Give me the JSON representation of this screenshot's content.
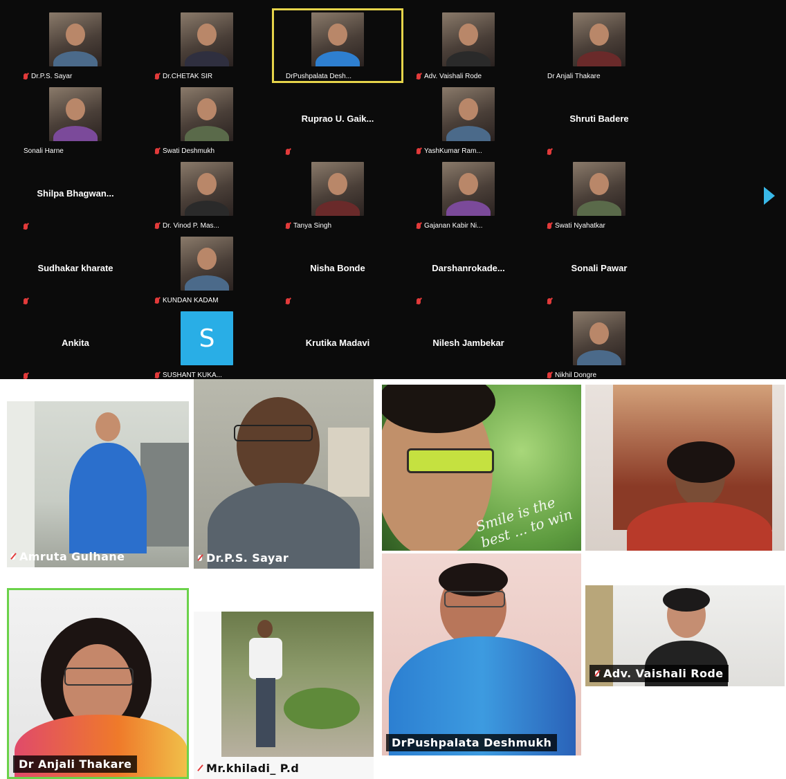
{
  "grid": {
    "rows": [
      [
        {
          "label": "Dr.P.S. Sayar",
          "video": true,
          "muted": true
        },
        {
          "label": "Dr.CHETAK SIR",
          "video": true,
          "muted": true
        },
        {
          "label": "DrPushpalata Desh...",
          "video": true,
          "muted": false,
          "active": true
        },
        {
          "label": "Adv. Vaishali Rode",
          "video": true,
          "muted": true
        },
        {
          "label": "Dr Anjali Thakare",
          "video": true,
          "muted": false
        }
      ],
      [
        {
          "label": "Sonali Harne",
          "video": true,
          "muted": false
        },
        {
          "label": "Swati Deshmukh",
          "video": true,
          "muted": true
        },
        {
          "label": "",
          "video": false,
          "display": "Ruprao U. Gaik...",
          "muted": true
        },
        {
          "label": "YashKumar Ram...",
          "video": true,
          "muted": true
        },
        {
          "label": "",
          "video": false,
          "display": "Shruti Badere",
          "muted": true
        }
      ],
      [
        {
          "label": "",
          "video": false,
          "display": "Shilpa Bhagwan...",
          "muted": true
        },
        {
          "label": "Dr. Vinod P. Mas...",
          "video": true,
          "muted": true
        },
        {
          "label": "Tanya Singh",
          "video": true,
          "muted": true
        },
        {
          "label": "Gajanan Kabir Ni...",
          "video": true,
          "muted": true
        },
        {
          "label": "Swati Nyahatkar",
          "video": true,
          "muted": true
        }
      ],
      [
        {
          "label": "",
          "video": false,
          "display": "Sudhakar kharate",
          "muted": true
        },
        {
          "label": "KUNDAN KADAM",
          "video": true,
          "muted": true
        },
        {
          "label": "",
          "video": false,
          "display": "Nisha Bonde",
          "muted": true
        },
        {
          "label": "",
          "video": false,
          "display": "Darshanrokade...",
          "muted": true
        },
        {
          "label": "",
          "video": false,
          "display": "Sonali Pawar",
          "muted": true
        }
      ],
      [
        {
          "label": "",
          "video": false,
          "display": "Ankita",
          "muted": true
        },
        {
          "label": "SUSHANT KUKA...",
          "video": true,
          "muted": true,
          "letter": "S"
        },
        {
          "label": "",
          "video": false,
          "display": "Krutika Madavi",
          "muted": false
        },
        {
          "label": "",
          "video": false,
          "display": "Nilesh Jambekar",
          "muted": false
        },
        {
          "label": "Nikhil Dongre",
          "video": true,
          "muted": true
        }
      ]
    ]
  },
  "tiles": {
    "amruta": "Amruta Gulhane",
    "sayar": "Dr.P.S. Sayar",
    "chetak_caption": "Smile is the best ... to win a",
    "anjali_top": "",
    "anjali": "Dr Anjali Thakare",
    "khiladi": "Mr.khiladi_ P.d",
    "pushpalata": "DrPushpalata Deshmukh",
    "vaishali": "Adv. Vaishali Rode"
  },
  "colors": {
    "active_border": "#e6d44a",
    "speaker_border": "#6bd24a",
    "muted_mic": "#e23a3a",
    "next_arrow": "#39b8e8"
  }
}
